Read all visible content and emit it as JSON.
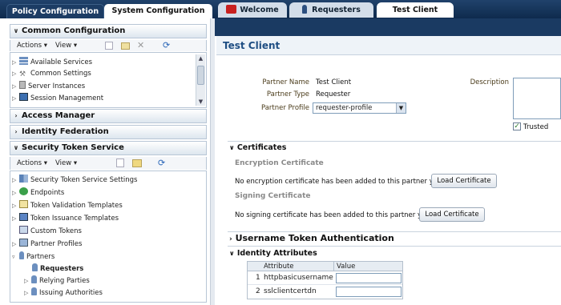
{
  "top_tabs": [
    "Policy Configuration",
    "System Configuration"
  ],
  "left": {
    "common_config": {
      "title": "Common Configuration",
      "actions_label": "Actions",
      "view_label": "View",
      "items": [
        "Available Services",
        "Common Settings",
        "Server Instances",
        "Session Management"
      ]
    },
    "access_manager": "Access Manager",
    "identity_federation": "Identity Federation",
    "sts": {
      "title": "Security Token Service",
      "actions_label": "Actions",
      "view_label": "View",
      "items": [
        "Security Token Service Settings",
        "Endpoints",
        "Token Validation Templates",
        "Token Issuance Templates",
        "Custom Tokens",
        "Partner Profiles",
        "Partners",
        "Requesters",
        "Relying Parties",
        "Issuing Authorities"
      ]
    }
  },
  "right_tabs": [
    "Welcome",
    "Requesters",
    "Test Client"
  ],
  "page_title": "Test Client",
  "form": {
    "partner_name_label": "Partner Name",
    "partner_name": "Test Client",
    "partner_type_label": "Partner Type",
    "partner_type": "Requester",
    "partner_profile_label": "Partner Profile",
    "partner_profile": "requester-profile",
    "description_label": "Description",
    "trusted_label": "Trusted"
  },
  "certificates": {
    "title": "Certificates",
    "encryption_heading": "Encryption Certificate",
    "encryption_text": "No encryption certificate has been added to this partner yet",
    "signing_heading": "Signing Certificate",
    "signing_text": "No signing certificate has been added to this partner yet",
    "load_button": "Load Certificate"
  },
  "username_token": "Username Token Authentication",
  "identity_attributes": {
    "title": "Identity Attributes",
    "columns": [
      "Attribute",
      "Value"
    ],
    "rows": [
      {
        "num": "1",
        "attr": "httpbasicusername",
        "value": ""
      },
      {
        "num": "2",
        "attr": "sslclientcertdn",
        "value": ""
      }
    ]
  },
  "colors": {
    "header_dark": "#0e2a4d",
    "title_blue": "#1f4e83",
    "tab_light": "#d3dde9"
  }
}
